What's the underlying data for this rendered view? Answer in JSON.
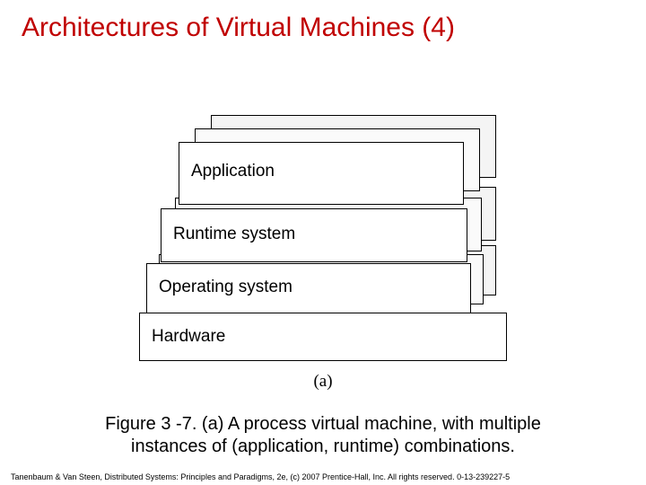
{
  "title": "Architectures of Virtual Machines (4)",
  "diagram": {
    "application": "Application",
    "runtime": "Runtime system",
    "os": "Operating system",
    "hardware": "Hardware",
    "sublabel": "(a)"
  },
  "caption_line1": "Figure 3 -7. (a) A process virtual machine, with multiple",
  "caption_line2": "instances of (application, runtime) combinations.",
  "copyright": "Tanenbaum & Van Steen, Distributed Systems: Principles and Paradigms, 2e, (c) 2007 Prentice-Hall, Inc. All rights reserved. 0-13-239227-5"
}
